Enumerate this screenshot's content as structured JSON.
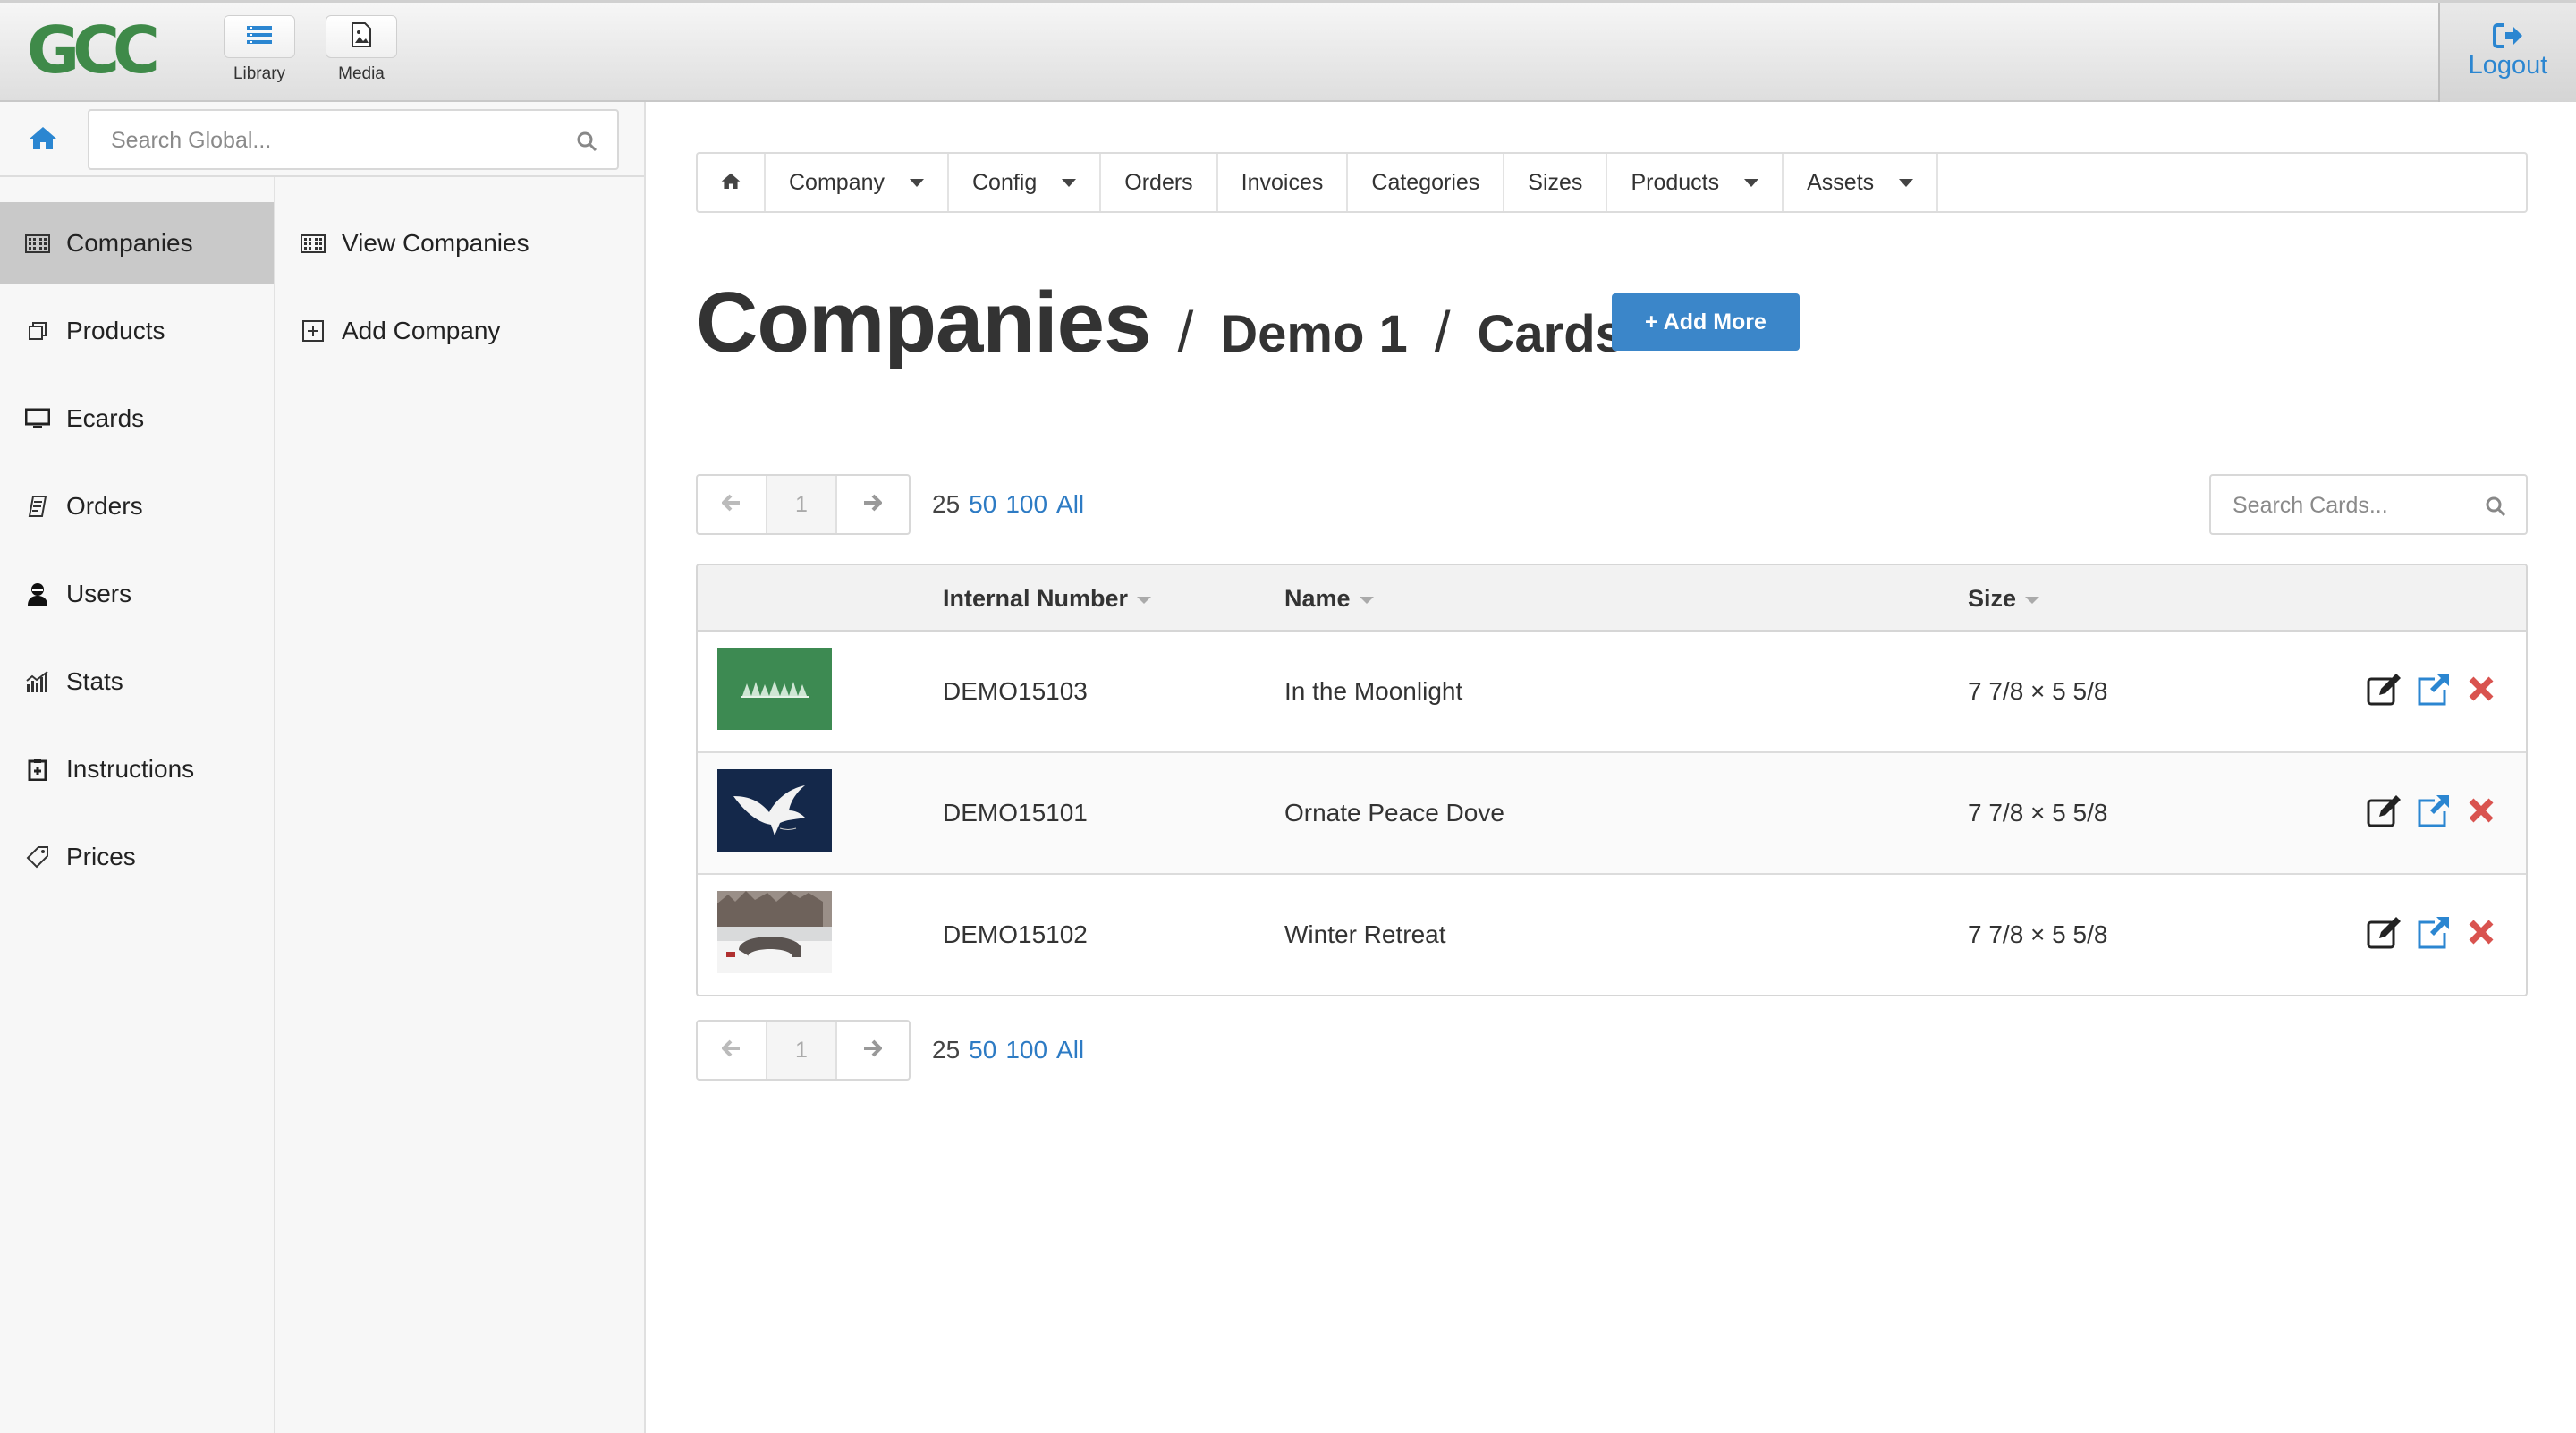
{
  "header": {
    "logo_text": "GCC",
    "tools": [
      {
        "label": "Library",
        "icon": "library-icon"
      },
      {
        "label": "Media",
        "icon": "media-icon"
      }
    ],
    "logout_label": "Logout",
    "accent_color": "#2b86d1"
  },
  "sidebar": {
    "search_placeholder": "Search Global...",
    "nav": [
      {
        "label": "Companies",
        "icon": "building-icon",
        "active": true
      },
      {
        "label": "Products",
        "icon": "products-icon"
      },
      {
        "label": "Ecards",
        "icon": "monitor-icon"
      },
      {
        "label": "Orders",
        "icon": "receipt-icon"
      },
      {
        "label": "Users",
        "icon": "user-icon"
      },
      {
        "label": "Stats",
        "icon": "bar-chart-icon"
      },
      {
        "label": "Instructions",
        "icon": "clipboard-icon"
      },
      {
        "label": "Prices",
        "icon": "tag-icon"
      }
    ],
    "sub": [
      {
        "label": "View Companies",
        "icon": "building-icon"
      },
      {
        "label": "Add Company",
        "icon": "plus-square-icon"
      }
    ]
  },
  "topnav": {
    "items": [
      {
        "label": "Company",
        "dropdown": true
      },
      {
        "label": "Config",
        "dropdown": true
      },
      {
        "label": "Orders",
        "dropdown": false
      },
      {
        "label": "Invoices",
        "dropdown": false
      },
      {
        "label": "Categories",
        "dropdown": false
      },
      {
        "label": "Sizes",
        "dropdown": false
      },
      {
        "label": "Products",
        "dropdown": true
      },
      {
        "label": "Assets",
        "dropdown": true
      }
    ]
  },
  "page": {
    "title": "Companies",
    "crumb1": "Demo 1",
    "crumb2": "Cards",
    "separator": "/",
    "add_more_label": "+ Add More",
    "add_more_color": "#3b86c9"
  },
  "pagination": {
    "current_page": "1",
    "per_page_options": [
      "25",
      "50",
      "100",
      "All"
    ],
    "per_page_selected": "25"
  },
  "search_cards": {
    "placeholder": "Search Cards..."
  },
  "table": {
    "columns": [
      "Internal Number",
      "Name",
      "Size"
    ],
    "rows": [
      {
        "internal_number": "DEMO15103",
        "name": "In the Moonlight",
        "size": "7 7/8 × 5 5/8",
        "thumb": "green-trees"
      },
      {
        "internal_number": "DEMO15101",
        "name": "Ornate Peace Dove",
        "size": "7 7/8 × 5 5/8",
        "thumb": "navy-dove"
      },
      {
        "internal_number": "DEMO15102",
        "name": "Winter Retreat",
        "size": "7 7/8 × 5 5/8",
        "thumb": "snow-bridge"
      }
    ],
    "delete_color": "#d9534f"
  }
}
